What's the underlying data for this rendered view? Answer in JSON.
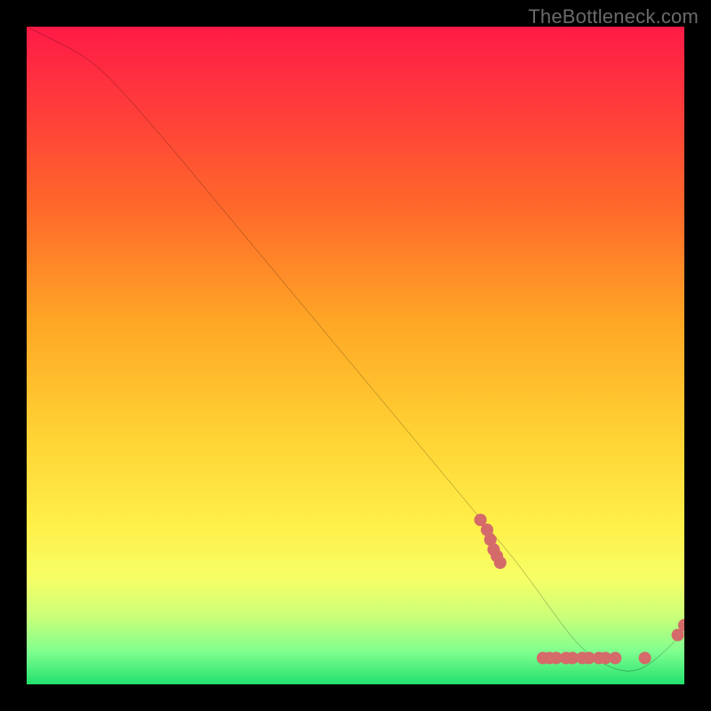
{
  "watermark": "TheBottleneck.com",
  "chart_data": {
    "type": "line",
    "title": "",
    "xlabel": "",
    "ylabel": "",
    "xlim": [
      0,
      100
    ],
    "ylim": [
      0,
      100
    ],
    "series": [
      {
        "name": "bottleneck-curve",
        "x": [
          0,
          4,
          8,
          12,
          20,
          30,
          40,
          50,
          60,
          70,
          75,
          80,
          83,
          86,
          90,
          93,
          96,
          100
        ],
        "y": [
          100,
          98,
          96,
          93,
          84,
          72,
          60,
          48,
          36,
          24,
          18,
          11,
          7,
          4,
          2,
          2,
          4,
          8
        ]
      }
    ],
    "scatter_clusters": [
      {
        "name": "upper-cluster",
        "points": [
          [
            69.0,
            25.0
          ],
          [
            70.0,
            23.5
          ],
          [
            70.5,
            22.0
          ],
          [
            71.0,
            20.5
          ],
          [
            71.5,
            19.5
          ],
          [
            72.0,
            18.5
          ]
        ]
      },
      {
        "name": "bottom-cluster",
        "points": [
          [
            78.5,
            4.0
          ],
          [
            79.5,
            4.0
          ],
          [
            80.5,
            4.0
          ],
          [
            82.0,
            4.0
          ],
          [
            83.0,
            4.0
          ],
          [
            84.5,
            4.0
          ],
          [
            85.5,
            4.0
          ],
          [
            87.0,
            4.0
          ],
          [
            88.0,
            4.0
          ],
          [
            89.5,
            4.0
          ]
        ]
      },
      {
        "name": "rise-cluster",
        "points": [
          [
            94.0,
            4.0
          ],
          [
            99.0,
            7.5
          ],
          [
            100.0,
            9.0
          ]
        ]
      }
    ],
    "colors": {
      "curve": "#000000",
      "dots": "#d46a6a",
      "gradient_top": "#ff1a47",
      "gradient_bottom": "#22e06e"
    }
  }
}
